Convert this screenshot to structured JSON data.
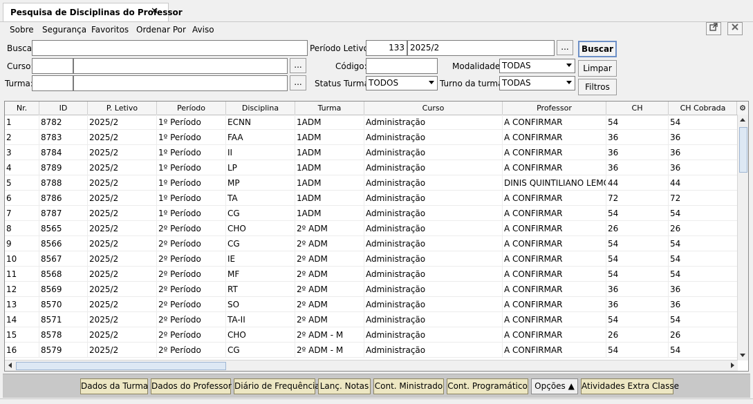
{
  "tab": {
    "title": "Pesquisa de Disciplinas do Professor",
    "close": "✕"
  },
  "menu": [
    "Sobre",
    "Segurança",
    "Favoritos",
    "Ordenar Por",
    "Aviso"
  ],
  "form": {
    "busca_label": "Busca:",
    "busca_value": "",
    "curso_label": "Curso:",
    "turma_label": "Turma:",
    "periodo_label": "Período Letivo:",
    "periodo_code": "133",
    "periodo_value": "2025/2",
    "codigo_label": "Código:",
    "codigo_value": "",
    "modalidade_label": "Modalidade:",
    "modalidade_value": "TODAS",
    "status_label": "Status Turma:",
    "status_value": "TODOS",
    "turno_label": "Turno da turma:",
    "turno_value": "TODAS",
    "dots": "...",
    "buscar": "Buscar",
    "limpar": "Limpar",
    "filtros": "Filtros"
  },
  "table": {
    "columns": [
      "Nr.",
      "ID",
      "P. Letivo",
      "Período",
      "Disciplina",
      "Turma",
      "Curso",
      "Professor",
      "CH",
      "CH Cobrada"
    ],
    "rows": [
      [
        "1",
        "8782",
        "2025/2",
        "1º Período",
        "ECNN",
        "1ADM",
        "Administração",
        "A CONFIRMAR",
        "54",
        "54"
      ],
      [
        "2",
        "8783",
        "2025/2",
        "1º Período",
        "FAA",
        "1ADM",
        "Administração",
        "A CONFIRMAR",
        "36",
        "36"
      ],
      [
        "3",
        "8784",
        "2025/2",
        "1º Período",
        "II",
        "1ADM",
        "Administração",
        "A CONFIRMAR",
        "36",
        "36"
      ],
      [
        "4",
        "8789",
        "2025/2",
        "1º Período",
        "LP",
        "1ADM",
        "Administração",
        "A CONFIRMAR",
        "36",
        "36"
      ],
      [
        "5",
        "8788",
        "2025/2",
        "1º Período",
        "MP",
        "1ADM",
        "Administração",
        "DINIS QUINTILIANO LEMOS",
        "44",
        "44"
      ],
      [
        "6",
        "8786",
        "2025/2",
        "1º Período",
        "TA",
        "1ADM",
        "Administração",
        "A CONFIRMAR",
        "72",
        "72"
      ],
      [
        "7",
        "8787",
        "2025/2",
        "1º Período",
        "CG",
        "1ADM",
        "Administração",
        "A CONFIRMAR",
        "54",
        "54"
      ],
      [
        "8",
        "8565",
        "2025/2",
        "2º Período",
        "CHO",
        "2º ADM",
        "Administração",
        "A CONFIRMAR",
        "26",
        "26"
      ],
      [
        "9",
        "8566",
        "2025/2",
        "2º Período",
        "CG",
        "2º ADM",
        "Administração",
        "A CONFIRMAR",
        "54",
        "54"
      ],
      [
        "10",
        "8567",
        "2025/2",
        "2º Período",
        "IE",
        "2º ADM",
        "Administração",
        "A CONFIRMAR",
        "54",
        "54"
      ],
      [
        "11",
        "8568",
        "2025/2",
        "2º Período",
        "MF",
        "2º ADM",
        "Administração",
        "A CONFIRMAR",
        "54",
        "54"
      ],
      [
        "12",
        "8569",
        "2025/2",
        "2º Período",
        "RT",
        "2º ADM",
        "Administração",
        "A CONFIRMAR",
        "36",
        "36"
      ],
      [
        "13",
        "8570",
        "2025/2",
        "2º Período",
        "SO",
        "2º ADM",
        "Administração",
        "A CONFIRMAR",
        "36",
        "36"
      ],
      [
        "14",
        "8571",
        "2025/2",
        "2º Período",
        "TA-II",
        "2º ADM",
        "Administração",
        "A CONFIRMAR",
        "54",
        "54"
      ],
      [
        "15",
        "8578",
        "2025/2",
        "2º Período",
        "CHO",
        "2º ADM - M",
        "Administração",
        "A CONFIRMAR",
        "26",
        "26"
      ],
      [
        "16",
        "8579",
        "2025/2",
        "2º Período",
        "CG",
        "2º ADM - M",
        "Administração",
        "A CONFIRMAR",
        "54",
        "54"
      ]
    ]
  },
  "toolbar": [
    "Dados da Turma",
    "Dados do Professor",
    "Diário de Frequência",
    "Lanç. Notas",
    "Cont. Ministrado",
    "Cont. Programático",
    "Opções ▲",
    "Atividades Extra Classe"
  ],
  "icons": {
    "external": "external-link-icon",
    "close": "close-icon",
    "gear": "gear-icon"
  }
}
